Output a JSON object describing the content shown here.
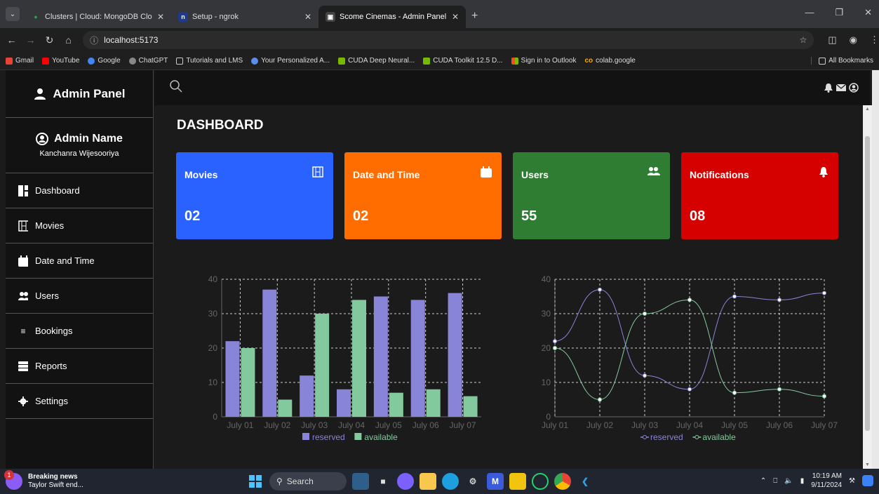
{
  "browser": {
    "tabs": [
      {
        "label": "Clusters | Cloud: MongoDB Clo"
      },
      {
        "label": "Setup - ngrok"
      },
      {
        "label": "Scome Cinemas - Admin Panel"
      }
    ],
    "url": "localhost:5173",
    "bookmarks": [
      "Gmail",
      "YouTube",
      "Google",
      "ChatGPT",
      "Tutorials and LMS",
      "Your Personalized A...",
      "CUDA Deep Neural...",
      "CUDA Toolkit 12.5 D...",
      "Sign in to Outlook",
      "colab.google"
    ],
    "all_bookmarks": "All Bookmarks"
  },
  "sidebar": {
    "header": "Admin Panel",
    "admin_title": "Admin Name",
    "admin_name": "Kanchanra Wijesooriya",
    "items": [
      {
        "label": "Dashboard",
        "icon": "dashboard-icon"
      },
      {
        "label": "Movies",
        "icon": "film-icon"
      },
      {
        "label": "Date and Time",
        "icon": "calendar-icon"
      },
      {
        "label": "Users",
        "icon": "users-icon"
      },
      {
        "label": "Bookings",
        "icon": "list-icon"
      },
      {
        "label": "Reports",
        "icon": "reports-icon"
      },
      {
        "label": "Settings",
        "icon": "gear-icon"
      }
    ]
  },
  "main": {
    "title": "DASHBOARD",
    "cards": [
      {
        "label": "Movies",
        "value": "02",
        "color": "#2962ff",
        "icon": "film-icon"
      },
      {
        "label": "Date and Time",
        "value": "02",
        "color": "#ff6d00",
        "icon": "calendar-icon"
      },
      {
        "label": "Users",
        "value": "55",
        "color": "#2e7d32",
        "icon": "users-icon"
      },
      {
        "label": "Notifications",
        "value": "08",
        "color": "#d50000",
        "icon": "bell-icon"
      }
    ]
  },
  "chart_data": [
    {
      "type": "bar",
      "categories": [
        "July 01",
        "July 02",
        "July 03",
        "July 04",
        "July 05",
        "July 06",
        "July 07"
      ],
      "series": [
        {
          "name": "reserved",
          "values": [
            22,
            37,
            12,
            8,
            35,
            34,
            36
          ],
          "color": "#8884d8"
        },
        {
          "name": "available",
          "values": [
            20,
            5,
            30,
            34,
            7,
            8,
            6
          ],
          "color": "#82ca9d"
        }
      ],
      "ylim": [
        0,
        40
      ],
      "yticks": [
        0,
        10,
        20,
        30,
        40
      ],
      "grid": true,
      "legend": "bottom"
    },
    {
      "type": "line",
      "categories": [
        "July 01",
        "July 02",
        "July 03",
        "July 04",
        "July 05",
        "July 06",
        "July 07"
      ],
      "series": [
        {
          "name": "reserved",
          "values": [
            22,
            37,
            12,
            8,
            35,
            34,
            36
          ],
          "color": "#8884d8"
        },
        {
          "name": "available",
          "values": [
            20,
            5,
            30,
            34,
            7,
            8,
            6
          ],
          "color": "#82ca9d"
        }
      ],
      "ylim": [
        0,
        40
      ],
      "yticks": [
        0,
        10,
        20,
        30,
        40
      ],
      "grid": true,
      "legend": "bottom"
    }
  ],
  "taskbar": {
    "news_title": "Breaking news",
    "news_sub": "Taylor Swift end...",
    "news_badge": "1",
    "search": "Search",
    "time": "10:19 AM",
    "date": "9/11/2024"
  }
}
